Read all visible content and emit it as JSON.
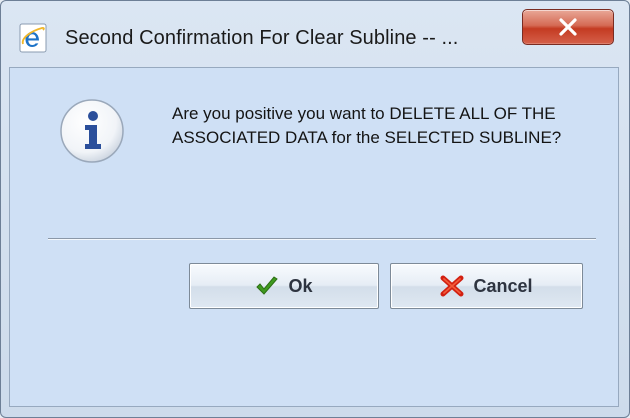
{
  "window": {
    "title": "Second Confirmation For Clear Subline -- ...",
    "title_icon": "ie-icon",
    "close_icon": "close-icon"
  },
  "dialog": {
    "message": "Are you positive you want to DELETE ALL OF THE ASSOCIATED DATA for the SELECTED SUBLINE?",
    "icon": "info-icon"
  },
  "buttons": {
    "ok_label": "Ok",
    "ok_icon": "checkmark-icon",
    "cancel_label": "Cancel",
    "cancel_icon": "red-x-icon"
  },
  "colors": {
    "client_background": "#cfe0f5",
    "close_button": "#c43b22",
    "info_icon": "#2b4f9b",
    "ok_check": "#3f9a1f",
    "cancel_x": "#d21f10"
  }
}
